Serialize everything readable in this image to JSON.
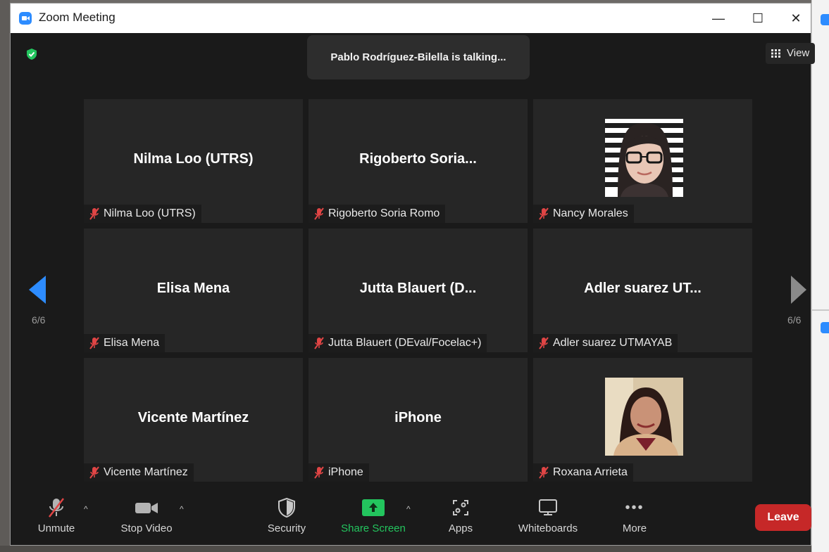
{
  "window": {
    "title": "Zoom Meeting"
  },
  "window_controls": {
    "minimize": "—",
    "maximize": "☐",
    "close": "✕"
  },
  "banner": {
    "talking": "Pablo Rodríguez-Bilella is talking..."
  },
  "view_button": {
    "label": "View"
  },
  "pagination": {
    "left": "6/6",
    "right": "6/6"
  },
  "tiles": [
    {
      "display_name": "Nilma Loo (UTRS)",
      "nametag": "Nilma Loo (UTRS)",
      "has_photo": false
    },
    {
      "display_name": "Rigoberto  Soria...",
      "nametag": "Rigoberto Soria Romo",
      "has_photo": false
    },
    {
      "display_name": "",
      "nametag": "Nancy Morales",
      "has_photo": true
    },
    {
      "display_name": "Elisa Mena",
      "nametag": "Elisa Mena",
      "has_photo": false
    },
    {
      "display_name": "Jutta Blauert (D...",
      "nametag": "Jutta Blauert (DEval/Focelac+)",
      "has_photo": false
    },
    {
      "display_name": "Adler suarez UT...",
      "nametag": "Adler suarez UTMAYAB",
      "has_photo": false
    },
    {
      "display_name": "Vicente Martínez",
      "nametag": "Vicente Martínez",
      "has_photo": false
    },
    {
      "display_name": "iPhone",
      "nametag": "iPhone",
      "has_photo": false
    },
    {
      "display_name": "",
      "nametag": "Roxana Arrieta",
      "has_photo": true
    }
  ],
  "toolbar": {
    "unmute": "Unmute",
    "stop_video": "Stop Video",
    "security": "Security",
    "share_screen": "Share Screen",
    "apps": "Apps",
    "whiteboards": "Whiteboards",
    "more": "More",
    "leave": "Leave"
  },
  "colors": {
    "accent": "#2d8cff",
    "share_green": "#23c55e",
    "leave_red": "#c62828",
    "tile_bg": "#262626",
    "muted_red": "#e04545"
  }
}
